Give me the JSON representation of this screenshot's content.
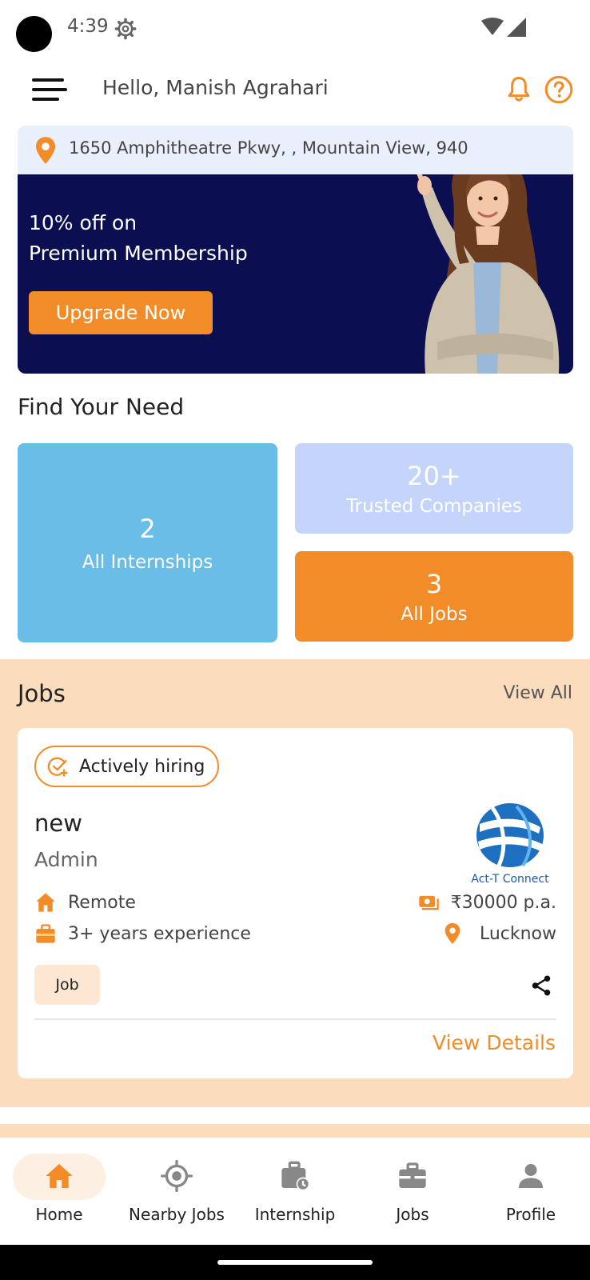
{
  "status_bar": {
    "time": "4:39"
  },
  "header": {
    "greeting": "Hello, Manish Agrahari"
  },
  "location": {
    "address": "1650 Amphitheatre Pkwy, , Mountain View, 940"
  },
  "banner": {
    "line1": "10% off on",
    "line2": "Premium Membership",
    "button_label": "Upgrade Now"
  },
  "find_need": {
    "title": "Find Your Need",
    "internships": {
      "count": "2",
      "label": "All Internships"
    },
    "companies": {
      "count": "20+",
      "label": "Trusted Companies"
    },
    "jobs": {
      "count": "3",
      "label": "All Jobs"
    }
  },
  "jobs": {
    "title": "Jobs",
    "view_all": "View All",
    "card": {
      "badge": "Actively hiring",
      "title": "new",
      "role": "Admin",
      "company_logo_text": "Act-T Connect",
      "work_mode": "Remote",
      "salary": "₹30000 p.a.",
      "experience": "3+ years experience",
      "city": "Lucknow",
      "type": "Job",
      "view_details": "View Details"
    }
  },
  "bottom_nav": {
    "items": [
      {
        "label": "Home",
        "icon": "home-icon",
        "active": true
      },
      {
        "label": "Nearby Jobs",
        "icon": "location-target-icon",
        "active": false
      },
      {
        "label": "Internship",
        "icon": "briefcase-clock-icon",
        "active": false
      },
      {
        "label": "Jobs",
        "icon": "briefcase-icon",
        "active": false
      },
      {
        "label": "Profile",
        "icon": "person-icon",
        "active": false
      }
    ]
  },
  "colors": {
    "accent": "#f28c28",
    "banner_bg": "#0b0f52",
    "jobs_section_bg": "#fbdcbd",
    "internship_tile": "#6abde6",
    "companies_tile": "#c4d4fb"
  }
}
